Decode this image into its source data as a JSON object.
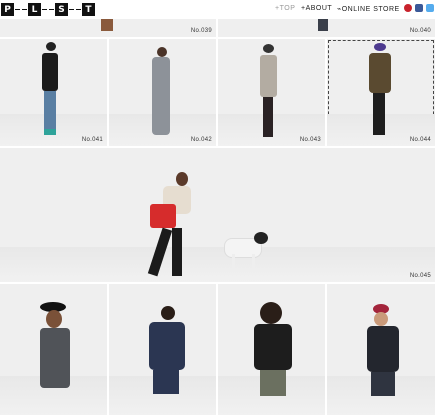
{
  "header": {
    "logo_letters": [
      "P",
      "L",
      "S",
      "T"
    ],
    "nav": {
      "top": "TOP",
      "about": "ABOUT",
      "store": "ONLINE STORE"
    },
    "social": [
      {
        "name": "pinterest-icon",
        "color": "#c8232c"
      },
      {
        "name": "facebook-icon",
        "color": "#3b5998"
      },
      {
        "name": "twitter-icon",
        "color": "#55acee"
      }
    ]
  },
  "looks": {
    "row0": [
      "No.039",
      "No.040"
    ],
    "row1": [
      "No.041",
      "No.042",
      "No.043",
      "No.044"
    ],
    "featured": "No.045"
  }
}
